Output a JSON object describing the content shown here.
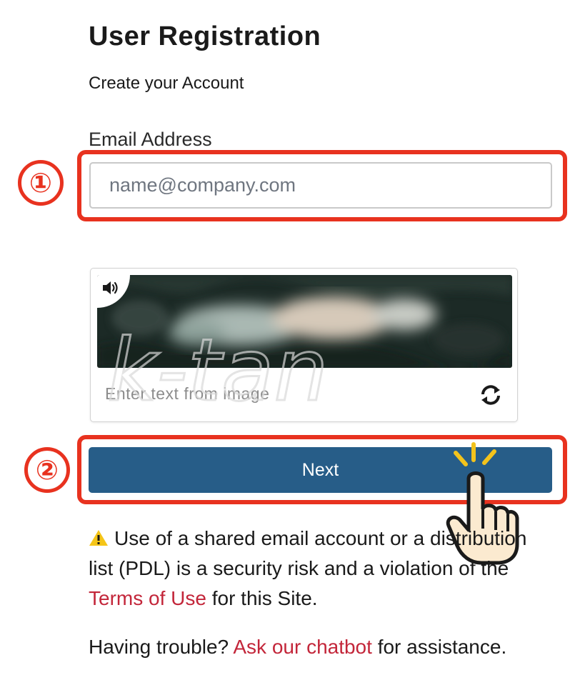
{
  "page": {
    "title": "User Registration",
    "subtitle": "Create your Account"
  },
  "form": {
    "email_label": "Email Address",
    "email_placeholder": "name@company.com",
    "email_value": "",
    "captcha_placeholder": "Enter text from image",
    "next_label": "Next"
  },
  "notice": {
    "warning_before_link": "Use of a shared email account or a distribution list (PDL) is a security risk and a violation of the",
    "terms_link": "Terms of Use",
    "warning_after_link": "for this Site.",
    "trouble_before_link": "Having trouble?",
    "chatbot_link": "Ask our chatbot",
    "trouble_after_link": "for assistance."
  },
  "annotations": {
    "step1": "①",
    "step2": "②",
    "watermark": "k-tan"
  },
  "colors": {
    "callout": "#e8321f",
    "button": "#275d88",
    "link": "#c3263a",
    "warning_icon": "#f5c518"
  },
  "icons": [
    "speaker-icon",
    "refresh-icon",
    "warning-icon",
    "pointing-hand-icon"
  ]
}
